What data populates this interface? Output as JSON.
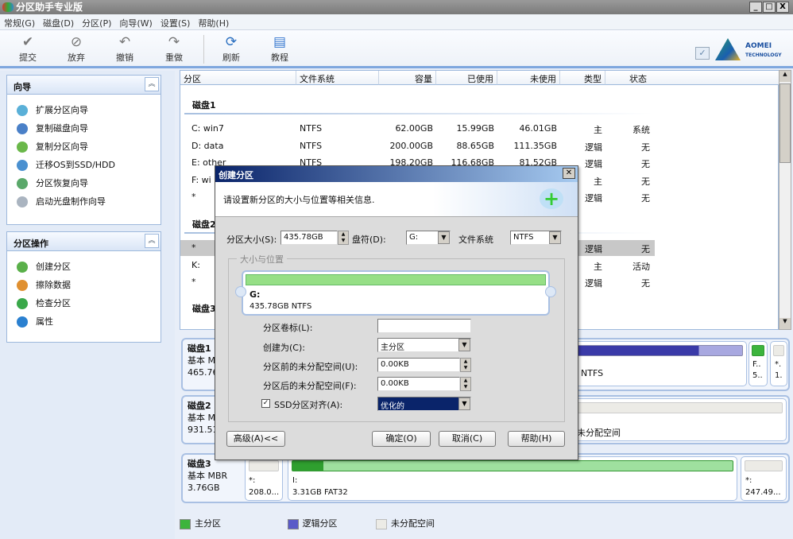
{
  "app": {
    "title": "分区助手专业版",
    "controls": [
      "_",
      "□",
      "X"
    ]
  },
  "menu": [
    "常规(G)",
    "磁盘(D)",
    "分区(P)",
    "向导(W)",
    "设置(S)",
    "帮助(H)"
  ],
  "toolbar": [
    {
      "label": "提交",
      "icon": "check-icon"
    },
    {
      "label": "放弃",
      "icon": "discard-icon"
    },
    {
      "label": "撤销",
      "icon": "undo-icon"
    },
    {
      "label": "重做",
      "icon": "redo-icon"
    },
    {
      "label": "刷新",
      "icon": "refresh-icon"
    },
    {
      "label": "教程",
      "icon": "book-icon"
    }
  ],
  "brand": {
    "name": "AOMEI",
    "sub": "TECHNOLOGY"
  },
  "sidebar": {
    "wizard": {
      "title": "向导",
      "items": [
        "扩展分区向导",
        "复制磁盘向导",
        "复制分区向导",
        "迁移OS到SSD/HDD",
        "分区恢复向导",
        "启动光盘制作向导"
      ]
    },
    "ops": {
      "title": "分区操作",
      "items": [
        "创建分区",
        "擦除数据",
        "检查分区",
        "属性"
      ]
    }
  },
  "table": {
    "columns": [
      "分区",
      "文件系统",
      "容量",
      "已使用",
      "未使用",
      "类型",
      "状态"
    ],
    "disk1": "磁盘1",
    "disk2": "磁盘2",
    "disk3": "磁盘3",
    "rows1": [
      [
        "C: win7",
        "NTFS",
        "62.00GB",
        "15.99GB",
        "46.01GB",
        "主",
        "系统"
      ],
      [
        "D: data",
        "NTFS",
        "200.00GB",
        "88.65GB",
        "111.35GB",
        "逻辑",
        "无"
      ],
      [
        "E: other",
        "NTFS",
        "198.20GB",
        "116.68GB",
        "81.52GB",
        "逻辑",
        "无"
      ],
      [
        "F: wi",
        "",
        "",
        "",
        "",
        "主",
        "无"
      ],
      [
        "*",
        "",
        "",
        "",
        "",
        "逻辑",
        "无"
      ]
    ],
    "rows2": [
      [
        "*",
        "",
        "",
        "",
        "",
        "逻辑",
        "无"
      ],
      [
        "K:",
        "",
        "",
        "",
        "",
        "主",
        "活动"
      ],
      [
        "*",
        "",
        "",
        "",
        "",
        "逻辑",
        "无"
      ]
    ]
  },
  "diskmap": {
    "disk1": {
      "name": "磁盘1",
      "type": "基本 MBR",
      "size": "465.76GB",
      "fs": "NTFS",
      "small1": [
        "F..",
        "5.."
      ],
      "small2": [
        "*.",
        "1."
      ]
    },
    "disk2": {
      "name": "磁盘2",
      "type": "基本 MBR",
      "size": "931.51GB",
      "label": "未分配空间"
    },
    "disk3": {
      "name": "磁盘3",
      "type": "基本 MBR",
      "size": "3.76GB",
      "p1": [
        "*:",
        "208.0..."
      ],
      "p2": [
        "I:",
        "3.31GB FAT32"
      ],
      "p3": [
        "*:",
        "247.49..."
      ]
    }
  },
  "legend": [
    "主分区",
    "逻辑分区",
    "未分配空间"
  ],
  "colors": {
    "primary": "#4cb84c",
    "logical": "#5a5ac8",
    "unallocated": "#ecebe6",
    "accent": "#0a246a"
  },
  "dialog": {
    "title": "创建分区",
    "header": "请设置新分区的大小与位置等相关信息.",
    "size_label": "分区大小(S):",
    "size_value": "435.78GB",
    "drive_label": "盘符(D):",
    "drive_value": "G:",
    "fs_label": "文件系统",
    "fs_value": "NTFS",
    "group": "大小与位置",
    "preview": {
      "name": "G:",
      "info": "435.78GB NTFS"
    },
    "vol_label": "分区卷标(L):",
    "vol_value": "",
    "create_label": "创建为(C):",
    "create_value": "主分区",
    "before_label": "分区前的未分配空间(U):",
    "before_value": "0.00KB",
    "after_label": "分区后的未分配空间(F):",
    "after_value": "0.00KB",
    "ssd_label": "SSD分区对齐(A):",
    "ssd_checked": true,
    "ssd_value": "优化的",
    "advanced": "高级(A)<<",
    "ok": "确定(O)",
    "cancel": "取消(C)",
    "help": "帮助(H)"
  }
}
